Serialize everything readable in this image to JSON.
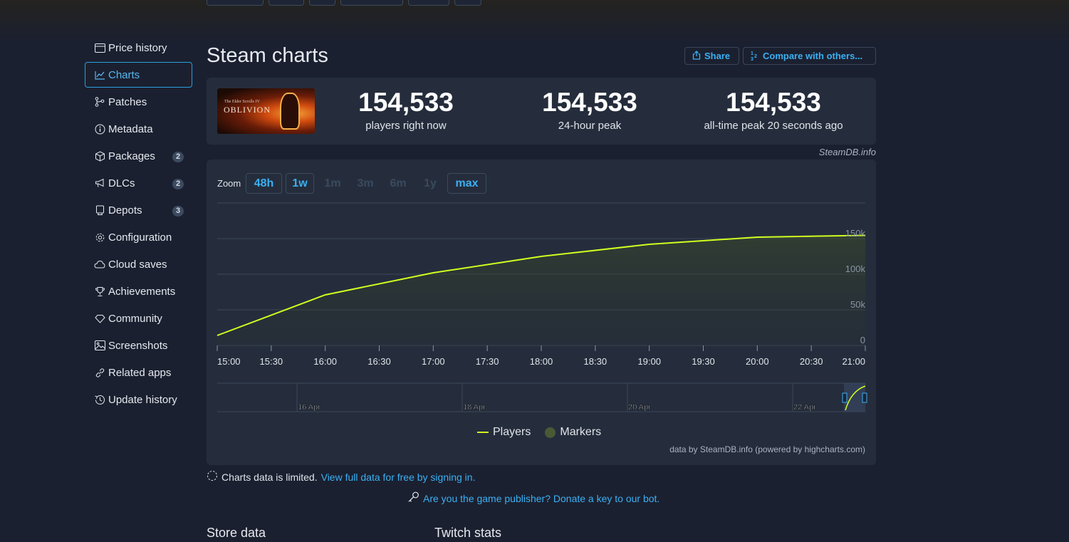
{
  "sidebar": {
    "items": [
      {
        "label": "Price history",
        "icon": "price-history-icon"
      },
      {
        "label": "Charts",
        "icon": "chart-line-icon",
        "active": true
      },
      {
        "label": "Patches",
        "icon": "git-branch-icon"
      },
      {
        "label": "Metadata",
        "icon": "info-icon"
      },
      {
        "label": "Packages",
        "icon": "package-icon",
        "badge": "2"
      },
      {
        "label": "DLCs",
        "icon": "megaphone-icon",
        "badge": "2"
      },
      {
        "label": "Depots",
        "icon": "depot-icon",
        "badge": "3"
      },
      {
        "label": "Configuration",
        "icon": "gear-icon"
      },
      {
        "label": "Cloud saves",
        "icon": "cloud-icon"
      },
      {
        "label": "Achievements",
        "icon": "trophy-icon"
      },
      {
        "label": "Community",
        "icon": "community-icon"
      },
      {
        "label": "Screenshots",
        "icon": "image-icon"
      },
      {
        "label": "Related apps",
        "icon": "link-icon"
      },
      {
        "label": "Update history",
        "icon": "history-icon"
      }
    ]
  },
  "header": {
    "title": "Steam charts",
    "share_label": "Share",
    "compare_label": "Compare with others..."
  },
  "game_image": {
    "small": "The Elder Scrolls IV",
    "big": "OBLIVION"
  },
  "stats": [
    {
      "value": "154,533",
      "label": "players right now"
    },
    {
      "value": "154,533",
      "label": "24-hour peak"
    },
    {
      "value": "154,533",
      "label": "all-time peak 20 seconds ago"
    }
  ],
  "credit_top": "SteamDB.info",
  "zoom": {
    "label": "Zoom",
    "options": [
      {
        "label": "48h",
        "enabled": true
      },
      {
        "label": "1w",
        "enabled": true
      },
      {
        "label": "1m",
        "enabled": false
      },
      {
        "label": "3m",
        "enabled": false
      },
      {
        "label": "6m",
        "enabled": false
      },
      {
        "label": "1y",
        "enabled": false
      },
      {
        "label": "max",
        "enabled": true
      }
    ]
  },
  "chart_data": {
    "type": "line",
    "series": [
      {
        "name": "Players",
        "color": "#d1ff1f"
      }
    ],
    "x": [
      "15:00",
      "16:00",
      "17:00",
      "18:00",
      "19:00",
      "20:00",
      "21:00"
    ],
    "y": [
      14000,
      71000,
      102000,
      125000,
      142000,
      152000,
      154533
    ],
    "x_tick_labels": [
      "15:00",
      "15:30",
      "16:00",
      "16:30",
      "17:00",
      "17:30",
      "18:00",
      "18:30",
      "19:00",
      "19:30",
      "20:00",
      "20:30",
      "21:00"
    ],
    "y_tick_labels": [
      "0",
      "50k",
      "100k",
      "150k"
    ],
    "ylim": [
      0,
      200000
    ],
    "navigator_labels": [
      "16 Apr",
      "18 Apr",
      "20 Apr",
      "22 Apr"
    ],
    "grid": true
  },
  "legend": {
    "players": "Players",
    "markers": "Markers"
  },
  "credit_bottom": "data by SteamDB.info (powered by highcharts.com)",
  "notice": {
    "text": "Charts data is limited.",
    "link": "View full data for free by signing in."
  },
  "publisher_link": "Are you the game publisher? Donate a key to our bot.",
  "sections": {
    "store": "Store data",
    "twitch": "Twitch stats"
  }
}
